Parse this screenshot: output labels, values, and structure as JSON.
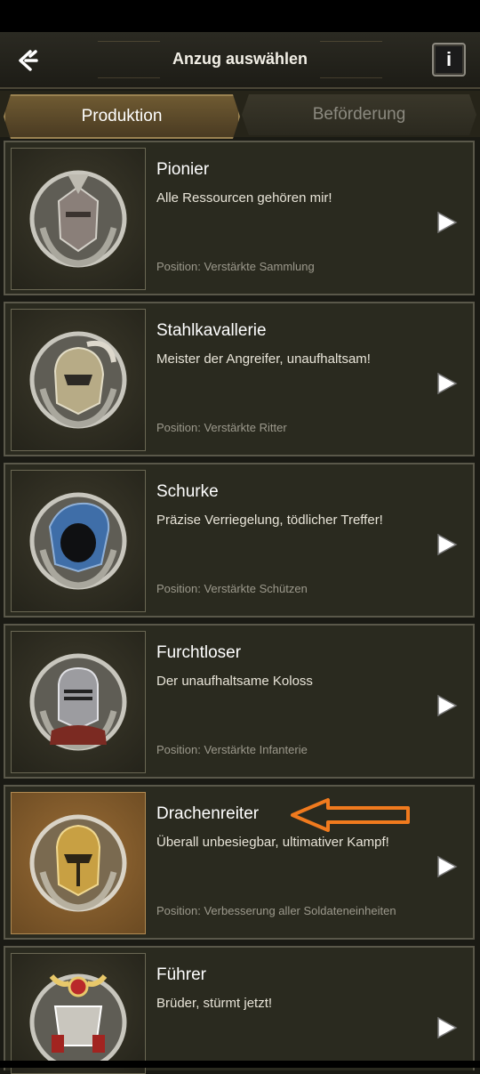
{
  "header": {
    "title": "Anzug auswählen"
  },
  "tabs": [
    {
      "label": "Produktion",
      "active": true
    },
    {
      "label": "Beförderung",
      "active": false
    }
  ],
  "suits": [
    {
      "name": "Pionier",
      "desc": "Alle Ressourcen gehören mir!",
      "position": "Position: Verstärkte Sammlung",
      "icon": "helmet-horned-icon"
    },
    {
      "name": "Stahlkavallerie",
      "desc": "Meister der Angreifer, unaufhaltsam!",
      "position": "Position: Verstärkte Ritter",
      "icon": "helmet-plumed-icon"
    },
    {
      "name": "Schurke",
      "desc": "Präzise Verriegelung, tödlicher Treffer!",
      "position": "Position: Verstärkte Schützen",
      "icon": "hood-icon"
    },
    {
      "name": "Furchtloser",
      "desc": "Der unaufhaltsame Koloss",
      "position": "Position: Verstärkte Infanterie",
      "icon": "helmet-knight-icon"
    },
    {
      "name": "Drachenreiter",
      "desc": "Überall unbesiegbar, ultimativer Kampf!",
      "position": "Position: Verbesserung aller Soldateneinheiten",
      "icon": "helmet-gold-icon",
      "highlighted": true
    },
    {
      "name": "Führer",
      "desc": "Brüder, stürmt jetzt!",
      "position": "",
      "icon": "samurai-helmet-icon"
    }
  ],
  "colors": {
    "accent": "#f07a1e",
    "tab_active": "#6f5a32",
    "card_bg": "#2a2a1f"
  }
}
